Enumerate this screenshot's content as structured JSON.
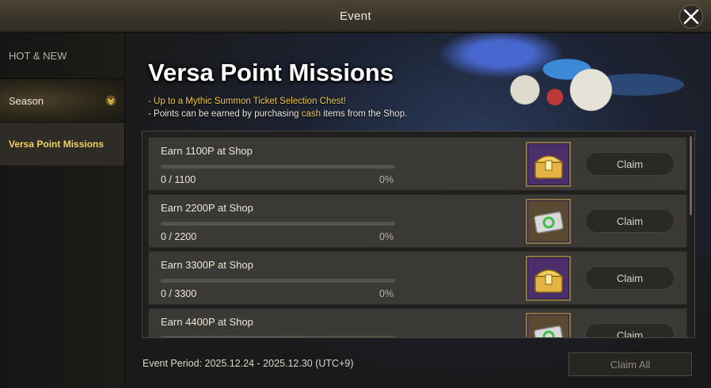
{
  "window": {
    "title": "Event"
  },
  "sidebar": {
    "section_label": "HOT & NEW",
    "season_label": "Season",
    "active_label": "Versa Point Missions"
  },
  "banner": {
    "title": "Versa Point Missions",
    "line1": "- Up to a Mythic Summon Ticket Selection Chest!",
    "line2_prefix": "- Points can be earned by purchasing ",
    "line2_highlight": "cash",
    "line2_suffix": " items from the Shop."
  },
  "missions": [
    {
      "title": "Earn 1100P at Shop",
      "count": "0 / 1100",
      "percent": "0%",
      "progress": 0,
      "reward_icon": "treasure-chest-icon",
      "claim_label": "Claim"
    },
    {
      "title": "Earn 2200P at Shop",
      "count": "0 / 2200",
      "percent": "0%",
      "progress": 0,
      "reward_icon": "summon-ticket-icon",
      "claim_label": "Claim"
    },
    {
      "title": "Earn 3300P at Shop",
      "count": "0 / 3300",
      "percent": "0%",
      "progress": 0,
      "reward_icon": "treasure-chest-icon",
      "claim_label": "Claim"
    },
    {
      "title": "Earn 4400P at Shop",
      "count": "",
      "percent": "",
      "progress": 0,
      "reward_icon": "summon-ticket-icon",
      "claim_label": "Claim"
    }
  ],
  "footer": {
    "period": "Event Period: 2025.12.24 - 2025.12.30 (UTC+9)",
    "claim_all_label": "Claim All"
  },
  "colors": {
    "accent_gold": "#f1d35c",
    "progress_fill": "#f0c24a",
    "highlight_text": "#f2c53c"
  }
}
